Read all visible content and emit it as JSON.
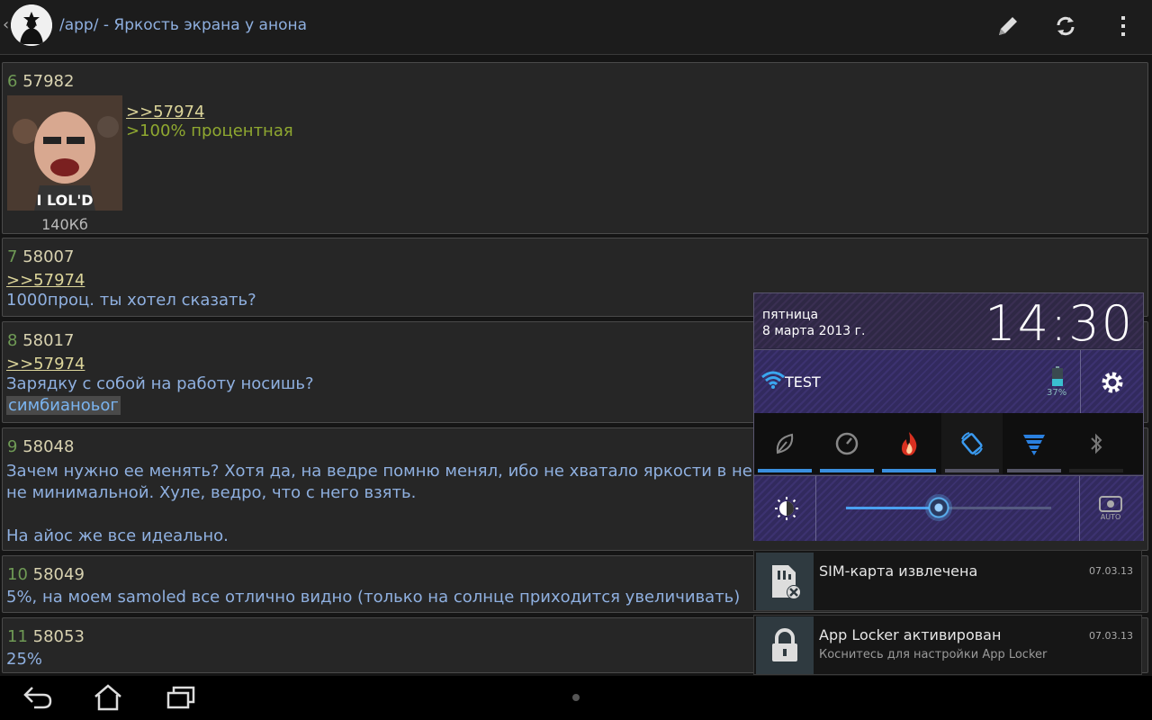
{
  "actionbar": {
    "title": "/app/ - Яркость экрана у анона",
    "actions": [
      "pencil-icon",
      "refresh-icon",
      "overflow-menu-icon"
    ]
  },
  "posts": [
    {
      "num": "6",
      "id": "57982",
      "ref": ">>57974",
      "quote": ">100% процентная",
      "thumb_label": "I LOL'D",
      "thumb_size": "140Кб"
    },
    {
      "num": "7",
      "id": "58007",
      "ref": ">>57974",
      "lines": [
        "1000проц. ты хотел сказать?"
      ]
    },
    {
      "num": "8",
      "id": "58017",
      "ref": ">>57974",
      "lines": [
        "Зарядку с собой на работу носишь?"
      ],
      "spoiler": "симбианоьог"
    },
    {
      "num": "9",
      "id": "58048",
      "lines": [
        "Зачем нужно ее менять? Хотя да, на ведре помню менял, ибо не хватало яркости в некот",
        "не минимальной. Хуле, ведро, что с него взять.",
        "",
        "На айос же все идеально."
      ]
    },
    {
      "num": "10",
      "id": "58049",
      "lines": [
        "5%, на моем samoled все отлично видно (только на солнце приходится увеличивать)"
      ]
    },
    {
      "num": "11",
      "id": "58053",
      "lines": [
        "25%"
      ]
    }
  ],
  "quick_settings": {
    "day": "пятница",
    "date": "8 марта 2013 г.",
    "clock": "14:30",
    "wifi_ssid": "TEST",
    "battery_percent": "37%",
    "brightness_level": 0.45,
    "auto_label": "AUTO"
  },
  "notifications": [
    {
      "title": "SIM-карта извлечена",
      "subtitle": "",
      "time": "07.03.13",
      "icon": "sim-removed-icon"
    },
    {
      "title": "App Locker активирован",
      "subtitle": "Коснитесь для настройки App Locker",
      "time": "07.03.13",
      "icon": "lock-icon"
    }
  ],
  "colors": {
    "accent": "#3a8fdf",
    "link": "#8fb0e0",
    "quote": "#8fa830"
  }
}
